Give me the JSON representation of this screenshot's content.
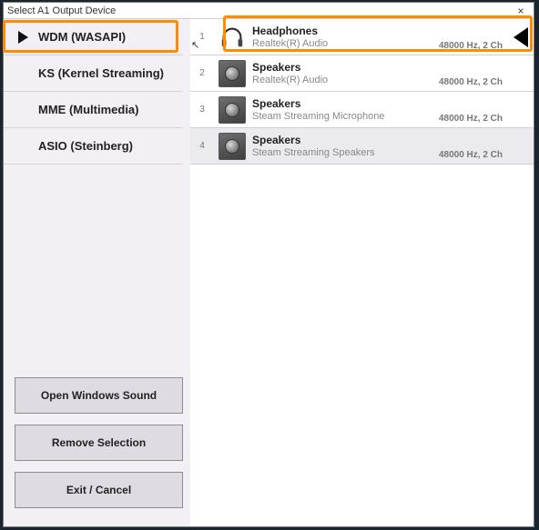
{
  "window": {
    "title": "Select A1 Output Device",
    "close_label": "×"
  },
  "drivers": {
    "selected_index": 0,
    "items": [
      {
        "label": "WDM (WASAPI)",
        "selected": true
      },
      {
        "label": "KS (Kernel Streaming)",
        "selected": false
      },
      {
        "label": "MME (Multimedia)",
        "selected": false
      },
      {
        "label": "ASIO (Steinberg)",
        "selected": false
      }
    ]
  },
  "devices": {
    "active_index": 0,
    "items": [
      {
        "num": "1",
        "icon": "headphones",
        "name": "Headphones",
        "sub": "Realtek(R) Audio",
        "meta": "48000 Hz, 2 Ch",
        "active": true,
        "hovered": false
      },
      {
        "num": "2",
        "icon": "speaker",
        "name": "Speakers",
        "sub": "Realtek(R) Audio",
        "meta": "48000 Hz, 2 Ch",
        "active": false,
        "hovered": false
      },
      {
        "num": "3",
        "icon": "speaker",
        "name": "Speakers",
        "sub": "Steam Streaming Microphone",
        "meta": "48000 Hz, 2 Ch",
        "active": false,
        "hovered": false
      },
      {
        "num": "4",
        "icon": "speaker",
        "name": "Speakers",
        "sub": "Steam Streaming Speakers",
        "meta": "48000 Hz, 2 Ch",
        "active": false,
        "hovered": true
      }
    ]
  },
  "buttons": {
    "open_sound": "Open Windows Sound",
    "remove_sel": "Remove Selection",
    "exit_cancel": "Exit / Cancel"
  }
}
